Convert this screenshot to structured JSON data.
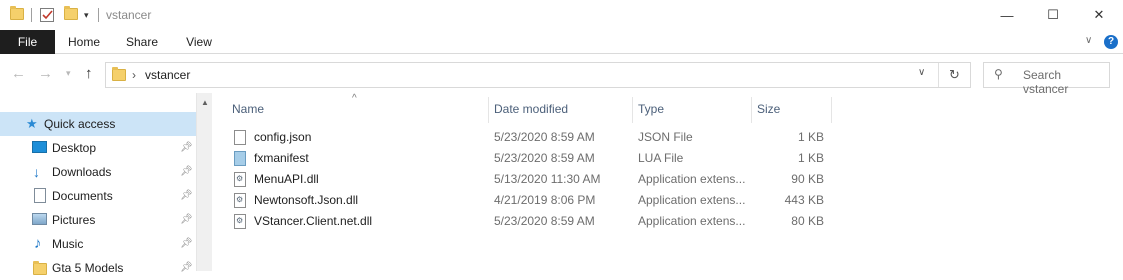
{
  "window": {
    "title": "vstancer",
    "controls": {
      "minimize": "—",
      "maximize": "☐",
      "close": "✕"
    }
  },
  "ribbon": {
    "tabs": [
      "File",
      "Home",
      "Share",
      "View"
    ],
    "expand_icon": "chevron-down-icon",
    "help_icon": "?"
  },
  "address": {
    "path": "vstancer",
    "separator": "›",
    "search_placeholder": "Search vstancer"
  },
  "nav": {
    "items": [
      {
        "label": "Quick access",
        "icon": "star-icon",
        "pinned": false,
        "selected": true
      },
      {
        "label": "Desktop",
        "icon": "desktop-icon",
        "pinned": true
      },
      {
        "label": "Downloads",
        "icon": "download-arrow-icon",
        "pinned": true
      },
      {
        "label": "Documents",
        "icon": "documents-icon",
        "pinned": true
      },
      {
        "label": "Pictures",
        "icon": "pictures-icon",
        "pinned": true
      },
      {
        "label": "Music",
        "icon": "music-note-icon",
        "pinned": true
      },
      {
        "label": "Gta 5 Models",
        "icon": "folder-icon",
        "pinned": true
      }
    ]
  },
  "files": {
    "columns": {
      "name": "Name",
      "date": "Date modified",
      "type": "Type",
      "size": "Size"
    },
    "sort_indicator": "^",
    "rows": [
      {
        "name": "config.json",
        "date": "5/23/2020 8:59 AM",
        "type": "JSON File",
        "size": "1 KB",
        "icon": "file-icon"
      },
      {
        "name": "fxmanifest",
        "date": "5/23/2020 8:59 AM",
        "type": "LUA File",
        "size": "1 KB",
        "icon": "lua-file-icon"
      },
      {
        "name": "MenuAPI.dll",
        "date": "5/13/2020 11:30 AM",
        "type": "Application extens...",
        "size": "90 KB",
        "icon": "dll-icon"
      },
      {
        "name": "Newtonsoft.Json.dll",
        "date": "4/21/2019 8:06 PM",
        "type": "Application extens...",
        "size": "443 KB",
        "icon": "dll-icon"
      },
      {
        "name": "VStancer.Client.net.dll",
        "date": "5/23/2020 8:59 AM",
        "type": "Application extens...",
        "size": "80 KB",
        "icon": "dll-icon"
      }
    ]
  }
}
